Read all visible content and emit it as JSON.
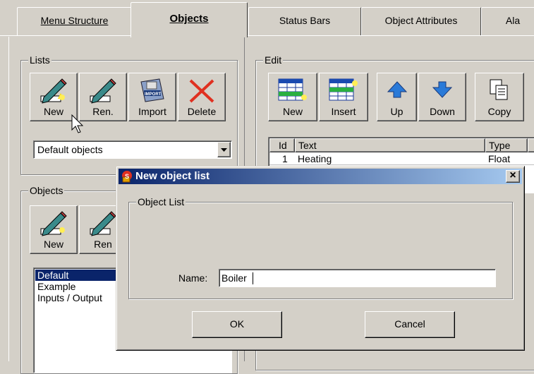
{
  "tabs": [
    {
      "label": "Menu Structure"
    },
    {
      "label": "Objects"
    },
    {
      "label": "Status Bars"
    },
    {
      "label": "Object Attributes"
    },
    {
      "label": "Ala"
    }
  ],
  "lists_group": {
    "title": "Lists",
    "buttons": [
      {
        "label": "New",
        "icon": "pencil-new-icon"
      },
      {
        "label": "Ren.",
        "icon": "pencil-rename-icon"
      },
      {
        "label": "Import",
        "icon": "import-icon"
      },
      {
        "label": "Delete",
        "icon": "red-x-delete-icon"
      }
    ],
    "dropdown_value": "Default objects"
  },
  "objects_group": {
    "title": "Objects",
    "buttons": [
      {
        "label": "New"
      },
      {
        "label": "Ren"
      }
    ],
    "list_items": [
      "Default",
      "Example",
      "Inputs / Output"
    ]
  },
  "edit_group": {
    "title": "Edit",
    "buttons": [
      {
        "label": "New"
      },
      {
        "label": "Insert"
      },
      {
        "label": "Up"
      },
      {
        "label": "Down"
      },
      {
        "label": "Copy"
      }
    ],
    "table": {
      "headers": [
        "Id",
        "Text",
        "Type"
      ],
      "rows": [
        [
          "1",
          "Heating",
          "Float"
        ]
      ]
    }
  },
  "dialog": {
    "title": "New object list",
    "close_label": "×",
    "group_title": "Object List",
    "name_label": "Name:",
    "name_value": "Boiler",
    "ok_label": "OK",
    "cancel_label": "Cancel"
  },
  "colors": {
    "face": "#d4d0c8",
    "title_start": "#0a246a",
    "title_end": "#a6caf0",
    "selection": "#0a246a"
  }
}
